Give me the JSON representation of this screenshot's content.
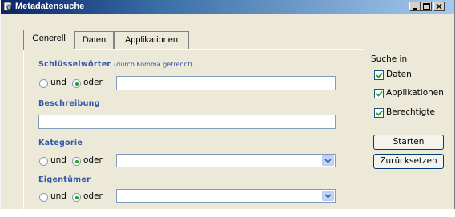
{
  "window": {
    "title": "Metadatensuche",
    "controls": [
      "minimize-icon",
      "maximize-icon",
      "close-icon"
    ]
  },
  "tabs": [
    {
      "label": "Generell",
      "active": true
    },
    {
      "label": "Daten",
      "active": false
    },
    {
      "label": "Applikationen",
      "active": false
    }
  ],
  "keywords": {
    "label": "Schlüsselwörter",
    "hint": "(durch Komma getrennt)",
    "option_and": "und",
    "option_or": "oder",
    "selected": "oder",
    "value": ""
  },
  "description": {
    "label": "Beschreibung",
    "value": ""
  },
  "category": {
    "label": "Kategorie",
    "option_and": "und",
    "option_or": "oder",
    "selected": "oder",
    "value": ""
  },
  "owner": {
    "label": "Eigentümer",
    "option_and": "und",
    "option_or": "oder",
    "selected": "oder",
    "value": ""
  },
  "search_in": {
    "label": "Suche in",
    "options": [
      {
        "label": "Daten",
        "checked": true
      },
      {
        "label": "Applikationen",
        "checked": true
      },
      {
        "label": "Berechtigte",
        "checked": true
      }
    ]
  },
  "buttons": {
    "start": "Starten",
    "reset": "Zurücksetzen"
  },
  "colors": {
    "section_label": "#3157a8",
    "radio_dot": "#21a121",
    "check_mark": "#21a121"
  }
}
